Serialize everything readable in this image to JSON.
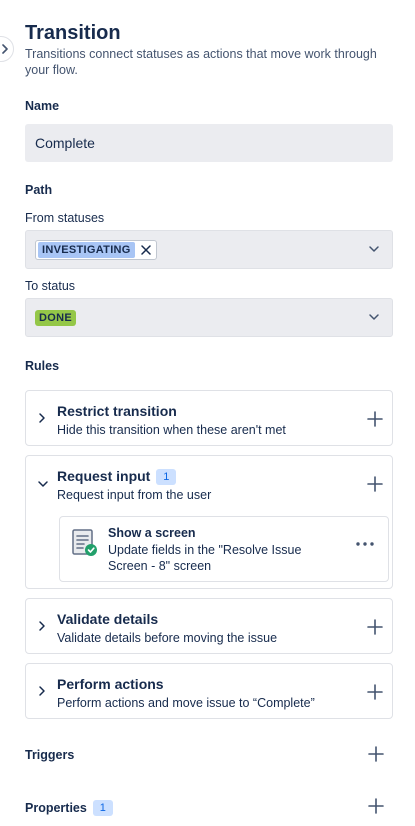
{
  "header": {
    "title": "Transition",
    "subtitle": "Transitions connect statuses as actions that move work through your flow."
  },
  "name": {
    "label": "Name",
    "value": "Complete"
  },
  "path": {
    "label": "Path",
    "from_label": "From statuses",
    "from_tags": [
      "INVESTIGATING"
    ],
    "to_label": "To status",
    "to_value": "DONE"
  },
  "rules": {
    "label": "Rules",
    "restrict": {
      "title": "Restrict transition",
      "desc": "Hide this transition when these aren't met"
    },
    "request": {
      "title": "Request input",
      "count": "1",
      "desc": "Request input from the user",
      "item": {
        "title": "Show a screen",
        "desc": "Update fields in the \"Resolve Issue Screen - 8\" screen"
      }
    },
    "validate": {
      "title": "Validate details",
      "desc": "Validate details before moving the issue"
    },
    "perform": {
      "title": "Perform actions",
      "desc": "Perform actions and move issue to “Complete”"
    }
  },
  "triggers": {
    "label": "Triggers"
  },
  "properties": {
    "label": "Properties",
    "count": "1"
  },
  "colors": {
    "accent_blue": "#a8c5f5",
    "done_green": "#94c748",
    "badge_bg": "#cce0ff",
    "badge_text": "#0c66e4"
  }
}
